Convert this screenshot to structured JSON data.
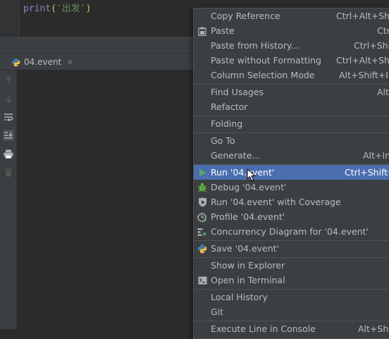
{
  "editor": {
    "code_fn": "print",
    "code_open": "(",
    "code_str": "'出发'",
    "code_close": ")"
  },
  "run_tab": {
    "label": "04.event",
    "close": "×"
  },
  "menu": {
    "copy_reference": {
      "label": "Copy Reference",
      "shortcut": "Ctrl+Alt+Shift"
    },
    "paste": {
      "label": "Paste",
      "shortcut": "Ctrl"
    },
    "paste_history": {
      "label": "Paste from History...",
      "shortcut": "Ctrl+Shift"
    },
    "paste_no_format": {
      "label": "Paste without Formatting",
      "shortcut": "Ctrl+Alt+Shift"
    },
    "column_selection": {
      "label": "Column Selection Mode",
      "shortcut": "Alt+Shift+Ins"
    },
    "find_usages": {
      "label": "Find Usages",
      "shortcut": "Alt"
    },
    "refactor": {
      "label": "Refactor",
      "shortcut": ""
    },
    "folding": {
      "label": "Folding",
      "shortcut": ""
    },
    "go_to": {
      "label": "Go To",
      "shortcut": ""
    },
    "generate": {
      "label": "Generate...",
      "shortcut": "Alt+Ins"
    },
    "run": {
      "label": "Run '04.event'",
      "shortcut": "Ctrl+Shift+"
    },
    "debug": {
      "label": "Debug '04.event'",
      "shortcut": ""
    },
    "run_coverage": {
      "label": "Run '04.event' with Coverage",
      "shortcut": ""
    },
    "profile": {
      "label": "Profile '04.event'",
      "shortcut": ""
    },
    "concurrency": {
      "label": "Concurrency Diagram for '04.event'",
      "shortcut": ""
    },
    "save": {
      "label": "Save '04.event'",
      "shortcut": ""
    },
    "show_explorer": {
      "label": "Show in Explorer",
      "shortcut": ""
    },
    "open_terminal": {
      "label": "Open in Terminal",
      "shortcut": ""
    },
    "local_history": {
      "label": "Local History",
      "shortcut": ""
    },
    "git": {
      "label": "Git",
      "shortcut": ""
    },
    "execute_console": {
      "label": "Execute Line in Console",
      "shortcut": "Alt+Shi"
    }
  },
  "colors": {
    "background": "#2b2b2b",
    "menu_background": "#3c3f41",
    "selection": "#4b6eaf",
    "run_green": "#499c54",
    "debug_green": "#62b543"
  }
}
